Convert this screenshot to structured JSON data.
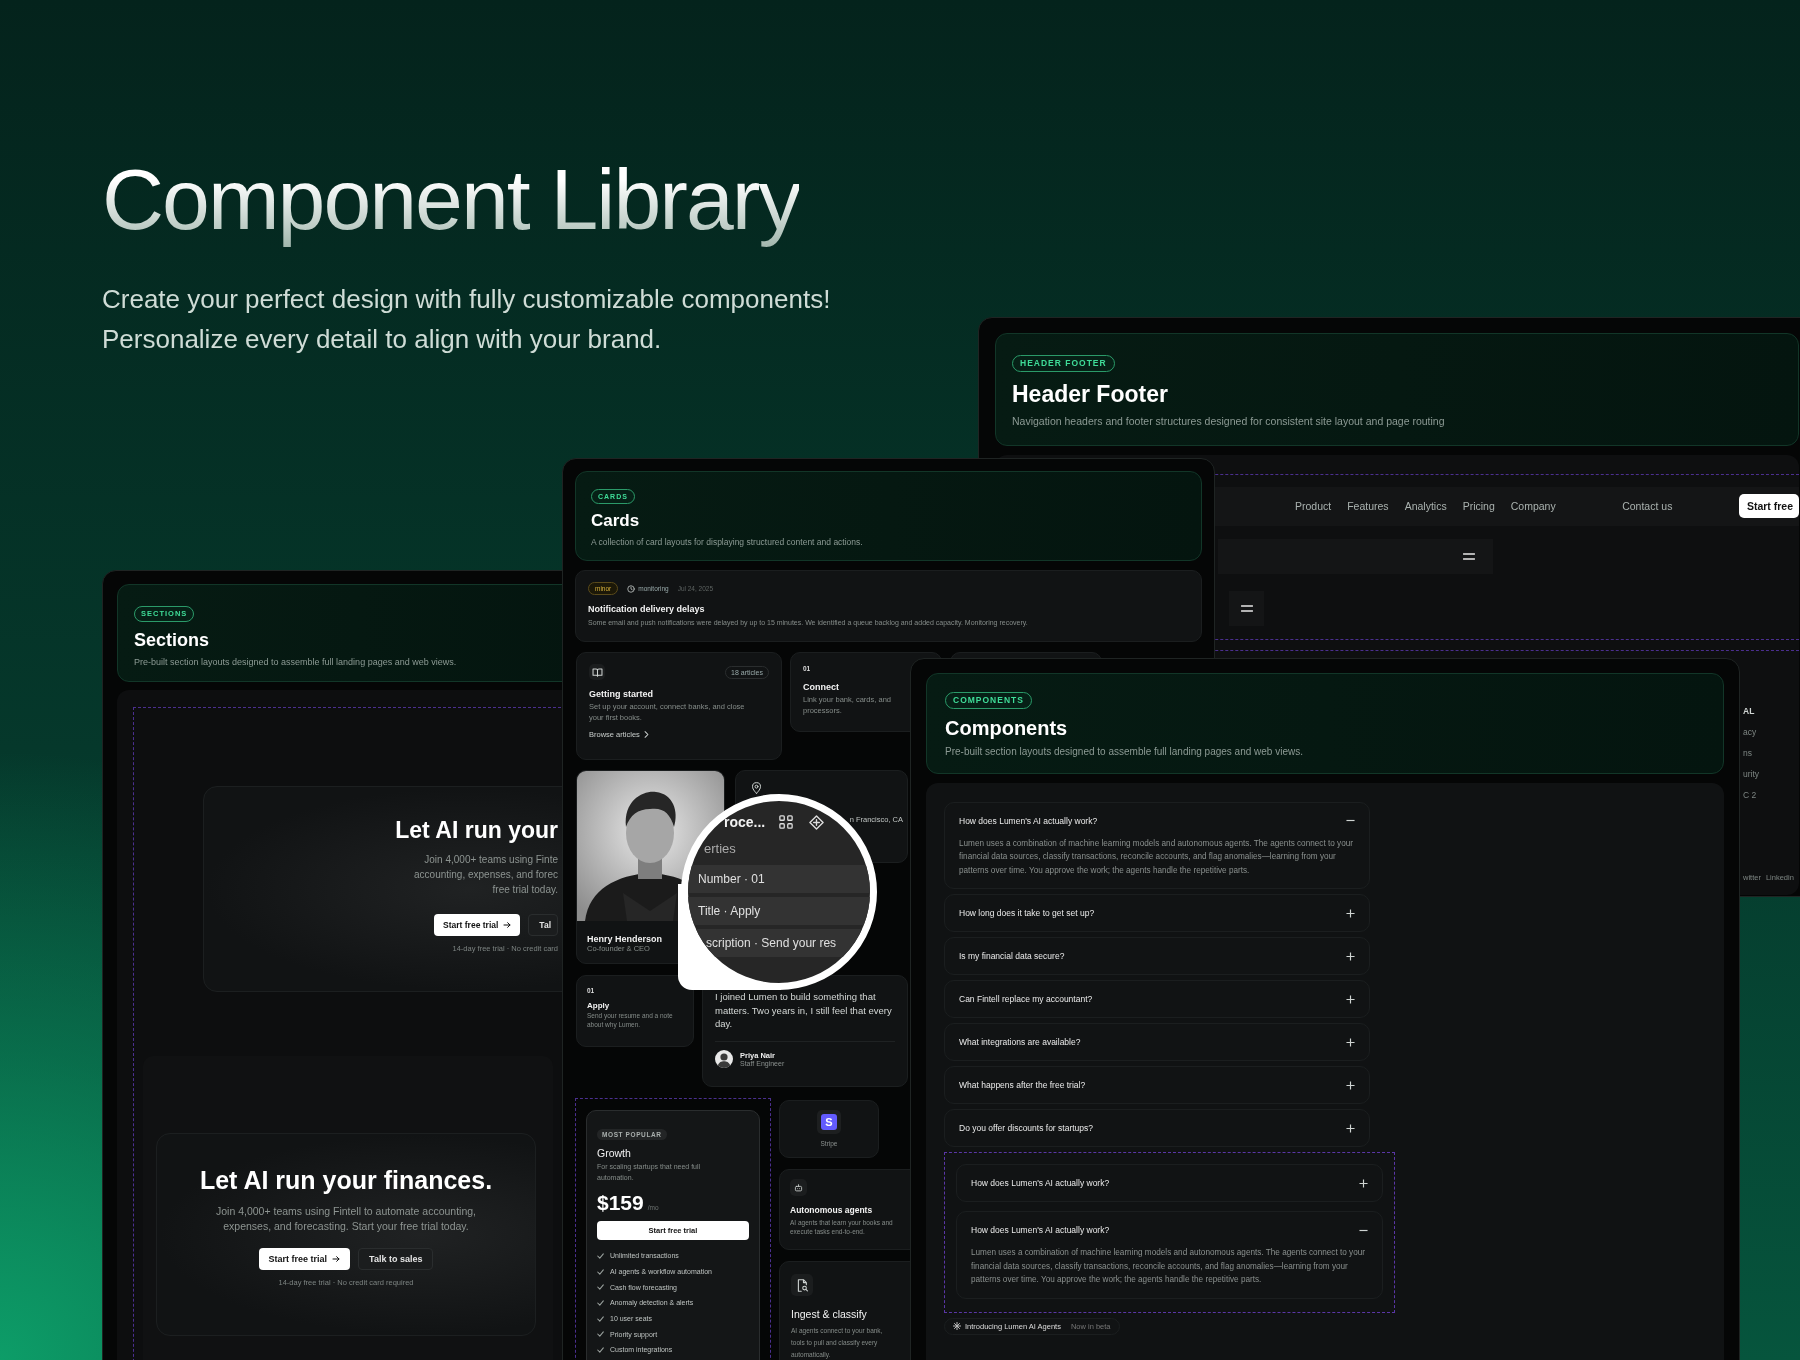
{
  "hero": {
    "title": "Component Library",
    "subtitle": "Create your perfect design with fully customizable components! Personalize every detail to align with your brand."
  },
  "header_footer": {
    "badge": "HEADER FOOTER",
    "title": "Header Footer",
    "description": "Navigation headers and footer structures designed for consistent site layout and page routing",
    "nav_links": [
      "Product",
      "Features",
      "Analytics",
      "Pricing",
      "Company"
    ],
    "contact": "Contact us",
    "cta": "Start free",
    "footer_heading": "AL",
    "footer_links": [
      "acy",
      "ns",
      "urity",
      "C 2"
    ],
    "social_links": [
      "witter",
      "Linkedin"
    ]
  },
  "sections": {
    "badge": "SECTIONS",
    "title": "Sections",
    "description": "Pre-built section layouts designed to assemble full landing pages and web views.",
    "heroes": [
      {
        "heading": "Let AI run your",
        "body_lines": [
          "Join 4,000+ teams using Finte",
          "accounting, expenses, and forec",
          "free trial today."
        ],
        "primary": "Start free trial",
        "secondary": "Tal",
        "note": "14-day free trial · No credit card"
      },
      {
        "heading": "Let AI run your finances.",
        "body": "Join 4,000+ teams using Fintell to automate accounting, expenses, and forecasting. Start your free trial today.",
        "primary": "Start free trial",
        "secondary": "Talk to sales",
        "note": "14-day free trial · No credit card required"
      }
    ]
  },
  "cards": {
    "badge": "CARDS",
    "title": "Cards",
    "description": "A collection of card layouts for displaying structured content and actions.",
    "incident": {
      "severity": "minor",
      "status": "monitoring",
      "date": "Jul 24, 2025",
      "title": "Notification delivery delays",
      "body": "Some email and push notifications were delayed by up to 15 minutes. We identified a queue backlog and added capacity. Monitoring recovery."
    },
    "guide": {
      "count": "18 articles",
      "title": "Getting started",
      "body": "Set up your account, connect banks, and close your first books.",
      "link": "Browse articles"
    },
    "connect": {
      "number": "01",
      "title": "Connect",
      "body": "Link your bank, cards, and processors."
    },
    "profile": {
      "kind": "picture",
      "name": "Henry Henderson",
      "role": "Co-founder & CEO"
    },
    "location": {
      "text": "n Francisco, CA"
    },
    "apply": {
      "number": "01",
      "title": "Apply",
      "body": "Send your resume and a note about why Lumen."
    },
    "testimonial": {
      "quote": "I joined Lumen to build something that matters. Two years in, I still feel that every day.",
      "name": "Priya Nair",
      "role": "Staff Engineer"
    },
    "pricing": {
      "badge": "MOST POPULAR",
      "plan": "Growth",
      "description": "For scaling startups that need full automation.",
      "price": "$159",
      "period": "/mo",
      "button": "Start free trial",
      "features": [
        "Unlimited transactions",
        "AI agents & workflow automation",
        "Cash flow forecasting",
        "Anomaly detection & alerts",
        "10 user seats",
        "Priority support",
        "Custom integrations"
      ]
    },
    "integration": {
      "logo": "S",
      "name": "Stripe"
    },
    "agents": {
      "title": "Autonomous agents",
      "body": "AI agents that learn your books and execute tasks end-to-end."
    },
    "ingest": {
      "title": "Ingest & classify",
      "body_lines": [
        "AI agents connect to your bank,",
        "tools to pull and classify every",
        "automatically."
      ]
    }
  },
  "lens": {
    "title": "roce...",
    "section": "erties",
    "rows": [
      "Number · 01",
      "Title · Apply",
      "scription · Send your res"
    ]
  },
  "components": {
    "badge": "COMPONENTS",
    "title": "Components",
    "description": "Pre-built section layouts designed to assemble full landing pages and web views.",
    "faq": [
      {
        "question": "How does Lumen's AI actually work?",
        "expanded": true,
        "answer": "Lumen uses a combination of machine learning models and autonomous agents. The agents connect to your financial data sources, classify transactions, reconcile accounts, and flag anomalies—learning from your patterns over time. You approve the work; the agents handle the repetitive parts."
      },
      {
        "question": "How long does it take to get set up?",
        "expanded": false
      },
      {
        "question": "Is my financial data secure?",
        "expanded": false
      },
      {
        "question": "Can Fintell replace my accountant?",
        "expanded": false
      },
      {
        "question": "What integrations are available?",
        "expanded": false
      },
      {
        "question": "What happens after the free trial?",
        "expanded": false
      },
      {
        "question": "Do you offer discounts for startups?",
        "expanded": false
      }
    ],
    "demo": [
      {
        "question": "How does Lumen's AI actually work?",
        "expanded": false
      },
      {
        "question": "How does Lumen's AI actually work?",
        "expanded": true,
        "answer": "Lumen uses a combination of machine learning models and autonomous agents. The agents connect to your financial data sources, classify transactions, reconcile accounts, and flag anomalies—learning from your patterns over time. You approve the work; the agents handle the repetitive parts."
      }
    ],
    "announcement": {
      "label": "Introducing Lumen AI Agents",
      "tag": "Now in beta"
    }
  }
}
